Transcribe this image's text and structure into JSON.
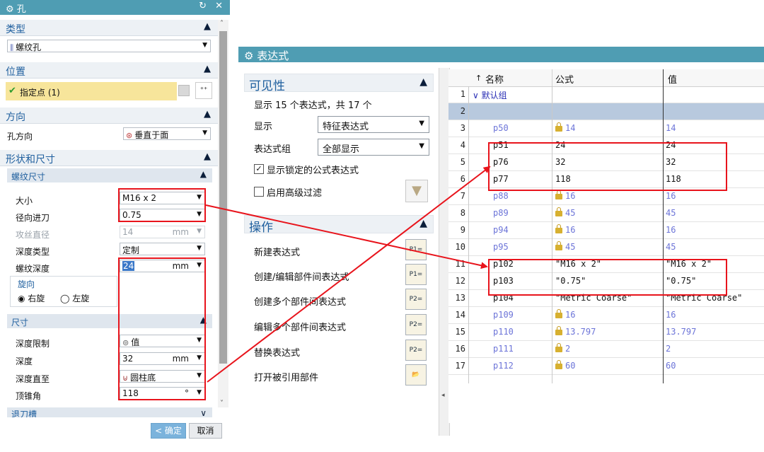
{
  "hole": {
    "title": "孔",
    "controls": "↻ ✕",
    "type_section": "类型",
    "type_value": "螺纹孔",
    "position_section": "位置",
    "specify_point": "指定点 (1)",
    "direction_section": "方向",
    "hole_direction_label": "孔方向",
    "hole_direction_value": "垂直于面",
    "shape_section": "形状和尺寸",
    "thread_dims_section": "螺纹尺寸",
    "size_label": "大小",
    "size_value": "M16 x 2",
    "radial_label": "径向进刀",
    "radial_value": "0.75",
    "tap_label": "攻丝直径",
    "tap_value": "14",
    "tap_unit": "mm",
    "depth_type_label": "深度类型",
    "depth_type_value": "定制",
    "thread_depth_label": "螺纹深度",
    "thread_depth_value": "24",
    "thread_depth_unit": "mm",
    "rotation_label": "旋向",
    "right_hand": "右旋",
    "left_hand": "左旋",
    "dims_section": "尺寸",
    "depth_limit_label": "深度限制",
    "depth_limit_value": "值",
    "depth_label": "深度",
    "depth_value": "32",
    "depth_unit": "mm",
    "depth_to_label": "深度直至",
    "depth_to_value": "圆柱底",
    "tip_angle_label": "顶锥角",
    "tip_angle_value": "118",
    "tip_angle_unit": "°",
    "relief_section": "退刀槽",
    "ok_button": "< 确定 >",
    "cancel_button": "取消"
  },
  "expr": {
    "title": "表达式",
    "visibility_section": "可见性",
    "display_count": "显示 15 个表达式，共 17 个",
    "show_label": "显示",
    "show_value": "特征表达式",
    "group_label": "表达式组",
    "group_value": "全部显示",
    "show_locked": "显示锁定的公式表达式",
    "advanced_filter": "启用高级过滤",
    "ops_section": "操作",
    "ops": [
      {
        "label": "新建表达式",
        "icon": "P1="
      },
      {
        "label": "创建/编辑部件间表达式",
        "icon": "P1="
      },
      {
        "label": "创建多个部件间表达式",
        "icon": "P2="
      },
      {
        "label": "编辑多个部件间表达式",
        "icon": "P2="
      },
      {
        "label": "替换表达式",
        "icon": "P2="
      },
      {
        "label": "打开被引用部件",
        "icon": "📂"
      }
    ],
    "table": {
      "col_name": "名称",
      "col_formula": "公式",
      "col_value": "值",
      "group_name": "默认组",
      "rows": [
        {
          "num": "1",
          "name": "默认组",
          "formula": "",
          "value": "",
          "locked": false,
          "color": "blue"
        },
        {
          "num": "2",
          "name": "",
          "formula": "",
          "value": "",
          "locked": false,
          "color": "blue"
        },
        {
          "num": "3",
          "name": "p50",
          "formula": "14",
          "value": "14",
          "locked": true,
          "color": "blue"
        },
        {
          "num": "4",
          "name": "p51",
          "formula": "24",
          "value": "24",
          "locked": false,
          "color": "blk"
        },
        {
          "num": "5",
          "name": "p76",
          "formula": "32",
          "value": "32",
          "locked": false,
          "color": "blk"
        },
        {
          "num": "6",
          "name": "p77",
          "formula": "118",
          "value": "118",
          "locked": false,
          "color": "blk"
        },
        {
          "num": "7",
          "name": "p88",
          "formula": "16",
          "value": "16",
          "locked": true,
          "color": "blue"
        },
        {
          "num": "8",
          "name": "p89",
          "formula": "45",
          "value": "45",
          "locked": true,
          "color": "blue"
        },
        {
          "num": "9",
          "name": "p94",
          "formula": "16",
          "value": "16",
          "locked": true,
          "color": "blue"
        },
        {
          "num": "10",
          "name": "p95",
          "formula": "45",
          "value": "45",
          "locked": true,
          "color": "blue"
        },
        {
          "num": "11",
          "name": "p102",
          "formula": "\"M16 x 2\"",
          "value": "\"M16 x 2\"",
          "locked": false,
          "color": "blk"
        },
        {
          "num": "12",
          "name": "p103",
          "formula": "\"0.75\"",
          "value": "\"0.75\"",
          "locked": false,
          "color": "blk"
        },
        {
          "num": "13",
          "name": "p104",
          "formula": "\"Metric Coarse\"",
          "value": "\"Metric Coarse\"",
          "locked": false,
          "color": "blk"
        },
        {
          "num": "14",
          "name": "p109",
          "formula": "16",
          "value": "16",
          "locked": true,
          "color": "blue"
        },
        {
          "num": "15",
          "name": "p110",
          "formula": "13.797",
          "value": "13.797",
          "locked": true,
          "color": "blue"
        },
        {
          "num": "16",
          "name": "p111",
          "formula": "2",
          "value": "2",
          "locked": true,
          "color": "blue"
        },
        {
          "num": "17",
          "name": "p112",
          "formula": "60",
          "value": "60",
          "locked": true,
          "color": "blue"
        }
      ]
    }
  },
  "colors": {
    "titlebar": "#4f9db3",
    "section_text": "#1f5f9e",
    "highlight": "#f7e59b",
    "annotation_red": "#e8141c",
    "unlocked_text": "#111111",
    "locked_text": "#6c74d8"
  }
}
